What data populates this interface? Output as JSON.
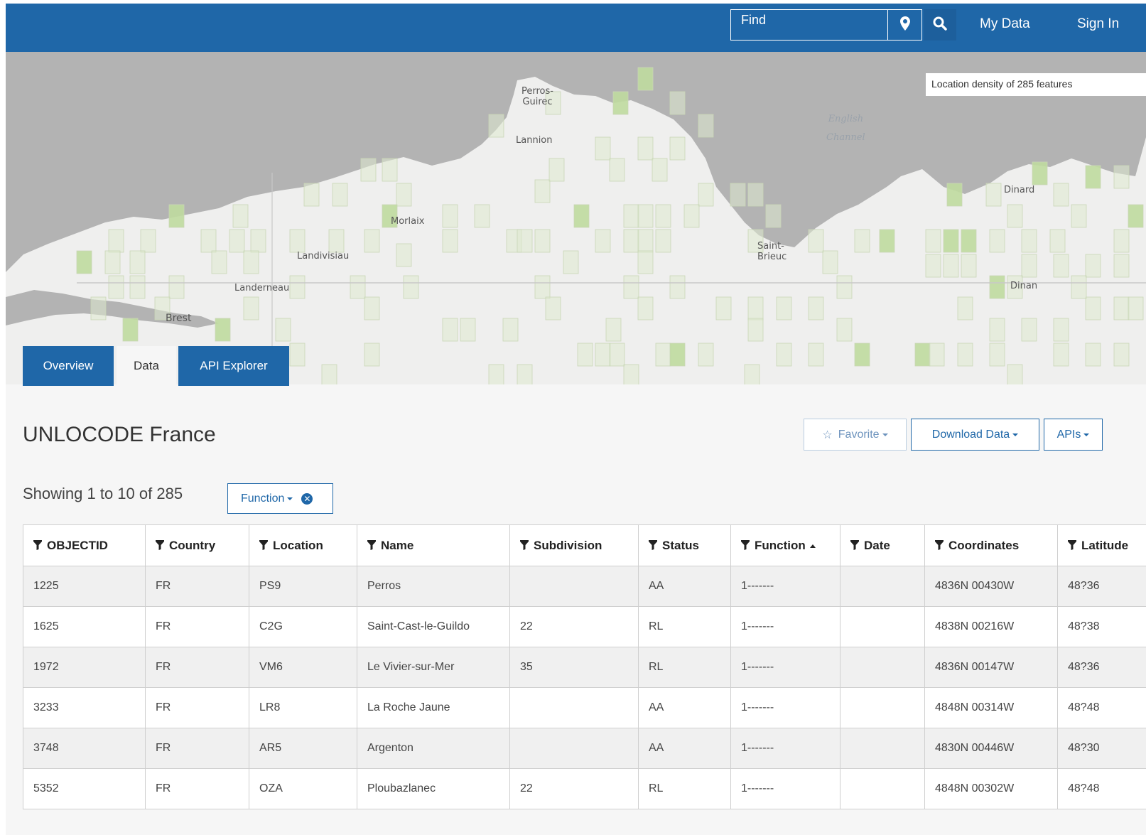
{
  "header": {
    "find_placeholder": "Find",
    "locate_icon": "map-pin-icon",
    "search_icon": "search-icon",
    "nav": [
      "My Data",
      "Sign In"
    ]
  },
  "map": {
    "density_label": "Location density of 285 features",
    "sea_label": "English\nChannel",
    "places": [
      {
        "name": "Perros-\nGuirec"
      },
      {
        "name": "Lannion"
      },
      {
        "name": "Morlaix"
      },
      {
        "name": "Landivisiau"
      },
      {
        "name": "Landerneau"
      },
      {
        "name": "Brest"
      },
      {
        "name": "Saint-\nBrieuc"
      },
      {
        "name": "Dinard"
      },
      {
        "name": "Dinan"
      }
    ],
    "land_color": "#efefee",
    "sea_color": "#b3b3b3",
    "grid_color": "#dfe9cf",
    "grid_dark_color": "#bfda9f"
  },
  "tabs": [
    {
      "label": "Overview",
      "active": false
    },
    {
      "label": "Data",
      "active": true
    },
    {
      "label": "API Explorer",
      "active": false
    }
  ],
  "dataset": {
    "title": "UNLOCODE France",
    "buttons": {
      "favorite": "Favorite",
      "favorite_icon": "star-icon",
      "download": "Download Data",
      "apis": "APIs"
    },
    "showing": "Showing 1 to 10 of 285",
    "filter_label": "Function",
    "filter_clear_icon": "close-circle-icon"
  },
  "table": {
    "columns": [
      "OBJECTID",
      "Country",
      "Location",
      "Name",
      "Subdivision",
      "Status",
      "Function",
      "Date",
      "Coordinates",
      "Latitude"
    ],
    "sorted_column": "Function",
    "sort_direction": "ascending",
    "rows": [
      [
        "1225",
        "FR",
        "PS9",
        "Perros",
        "",
        "AA",
        "1-------",
        "",
        "4836N 00430W",
        "48?36"
      ],
      [
        "1625",
        "FR",
        "C2G",
        "Saint-Cast-le-Guildo",
        "22",
        "RL",
        "1-------",
        "",
        "4838N 00216W",
        "48?38"
      ],
      [
        "1972",
        "FR",
        "VM6",
        "Le Vivier-sur-Mer",
        "35",
        "RL",
        "1-------",
        "",
        "4836N 00147W",
        "48?36"
      ],
      [
        "3233",
        "FR",
        "LR8",
        "La Roche Jaune",
        "",
        "AA",
        "1-------",
        "",
        "4848N 00314W",
        "48?48"
      ],
      [
        "3748",
        "FR",
        "AR5",
        "Argenton",
        "",
        "AA",
        "1-------",
        "",
        "4830N 00446W",
        "48?30"
      ],
      [
        "5352",
        "FR",
        "OZA",
        "Ploubazlanec",
        "22",
        "RL",
        "1-------",
        "",
        "4848N 00302W",
        "48?48"
      ]
    ]
  },
  "colors": {
    "brand": "#1f67a8",
    "table_stripe": "#f0f0f0"
  }
}
